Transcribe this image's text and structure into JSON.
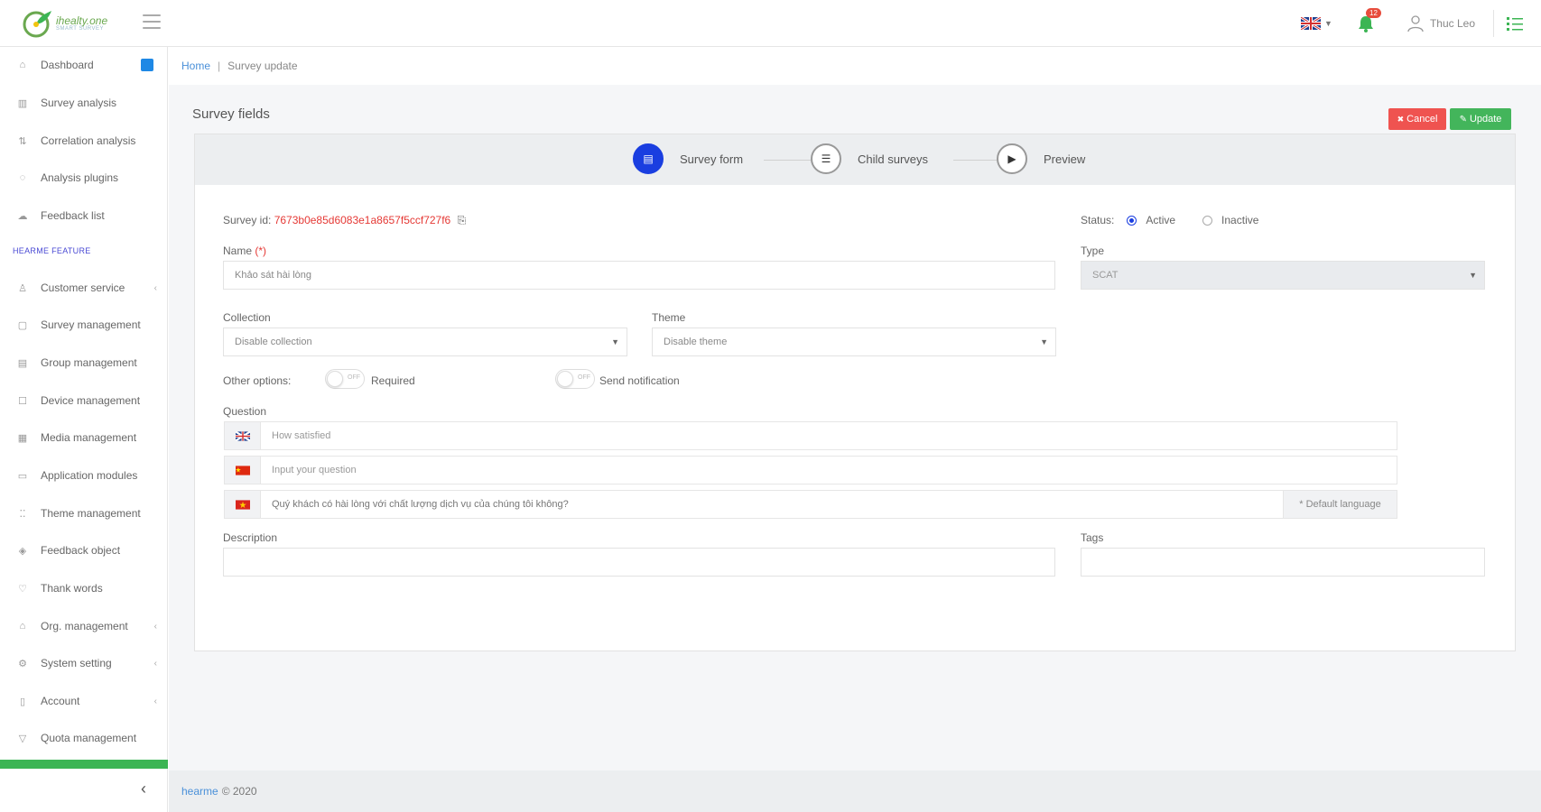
{
  "header": {
    "logo_line1": "ihealty.one",
    "logo_line2": "SMART SURVEY",
    "language": "EN",
    "notification_count": "12",
    "user_name": "Thuc Leo"
  },
  "sidebar": {
    "section_title": "HEARME FEATURE",
    "items": [
      {
        "label": "Dashboard",
        "icon": "home-icon"
      },
      {
        "label": "Survey analysis",
        "icon": "bar-chart-icon"
      },
      {
        "label": "Correlation analysis",
        "icon": "correlation-icon"
      },
      {
        "label": "Analysis plugins",
        "icon": "plugin-icon"
      },
      {
        "label": "Feedback list",
        "icon": "feedback-icon"
      },
      {
        "label": "Customer service",
        "icon": "customer-icon"
      },
      {
        "label": "Survey management",
        "icon": "survey-icon"
      },
      {
        "label": "Group management",
        "icon": "group-icon"
      },
      {
        "label": "Device management",
        "icon": "device-icon"
      },
      {
        "label": "Media management",
        "icon": "media-icon"
      },
      {
        "label": "Application modules",
        "icon": "module-icon"
      },
      {
        "label": "Theme management",
        "icon": "theme-icon"
      },
      {
        "label": "Feedback object",
        "icon": "object-icon"
      },
      {
        "label": "Thank words",
        "icon": "heart-icon"
      },
      {
        "label": "Org. management",
        "icon": "org-icon"
      },
      {
        "label": "System setting",
        "icon": "gear-icon"
      },
      {
        "label": "Account",
        "icon": "account-icon"
      },
      {
        "label": "Quota management",
        "icon": "quota-icon"
      }
    ]
  },
  "breadcrumb": {
    "home": "Home",
    "current": "Survey update"
  },
  "page": {
    "title": "Survey fields",
    "cancel_label": "Cancel",
    "update_label": "Update"
  },
  "steps": [
    {
      "label": "Survey form",
      "active": true
    },
    {
      "label": "Child surveys",
      "active": false
    },
    {
      "label": "Preview",
      "active": false
    }
  ],
  "form": {
    "survey_id_label": "Survey id:",
    "survey_id_value": "7673b0e85d6083e1a8657f5ccf727f6",
    "status_label": "Status:",
    "status_active": "Active",
    "status_inactive": "Inactive",
    "name_label": "Name",
    "required_mark": "(*)",
    "name_value": "Khảo sát hài lòng",
    "type_label": "Type",
    "type_value": "SCAT",
    "collection_label": "Collection",
    "collection_value": "Disable collection",
    "theme_label": "Theme",
    "theme_value": "Disable theme",
    "other_options_label": "Other options:",
    "toggle_off_text": "OFF",
    "required_toggle_label": "Required",
    "notification_toggle_label": "Send notification",
    "question_label": "Question",
    "questions": [
      {
        "lang": "en",
        "placeholder": "How satisfied",
        "value": ""
      },
      {
        "lang": "cn",
        "placeholder": "Input your question",
        "value": ""
      },
      {
        "lang": "vn",
        "placeholder": "",
        "value": "Quý khách có hài lòng với chất lượng dịch vụ của chúng tôi không?",
        "addon": "* Default language"
      }
    ],
    "description_label": "Description",
    "tags_label": "Tags"
  },
  "footer": {
    "link": "hearme",
    "text": "© 2020"
  }
}
